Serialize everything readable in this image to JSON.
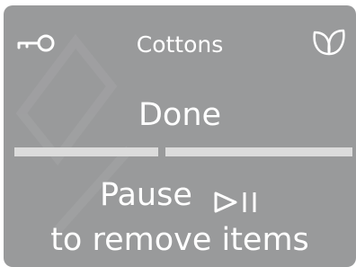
{
  "screen": {
    "program_name": "Cottons",
    "status_text": "Done",
    "instruction": {
      "line1": "Pause",
      "line2": "to remove items"
    },
    "icons": {
      "lock": "key-icon",
      "eco": "leaf-icon",
      "pause_play": "play-pause-icon"
    },
    "progress": {
      "completed_fraction": 1.0
    },
    "colors": {
      "panel_background": "#999a9b",
      "text": "#ffffff",
      "progress_bar": "#dcdcdc"
    }
  }
}
